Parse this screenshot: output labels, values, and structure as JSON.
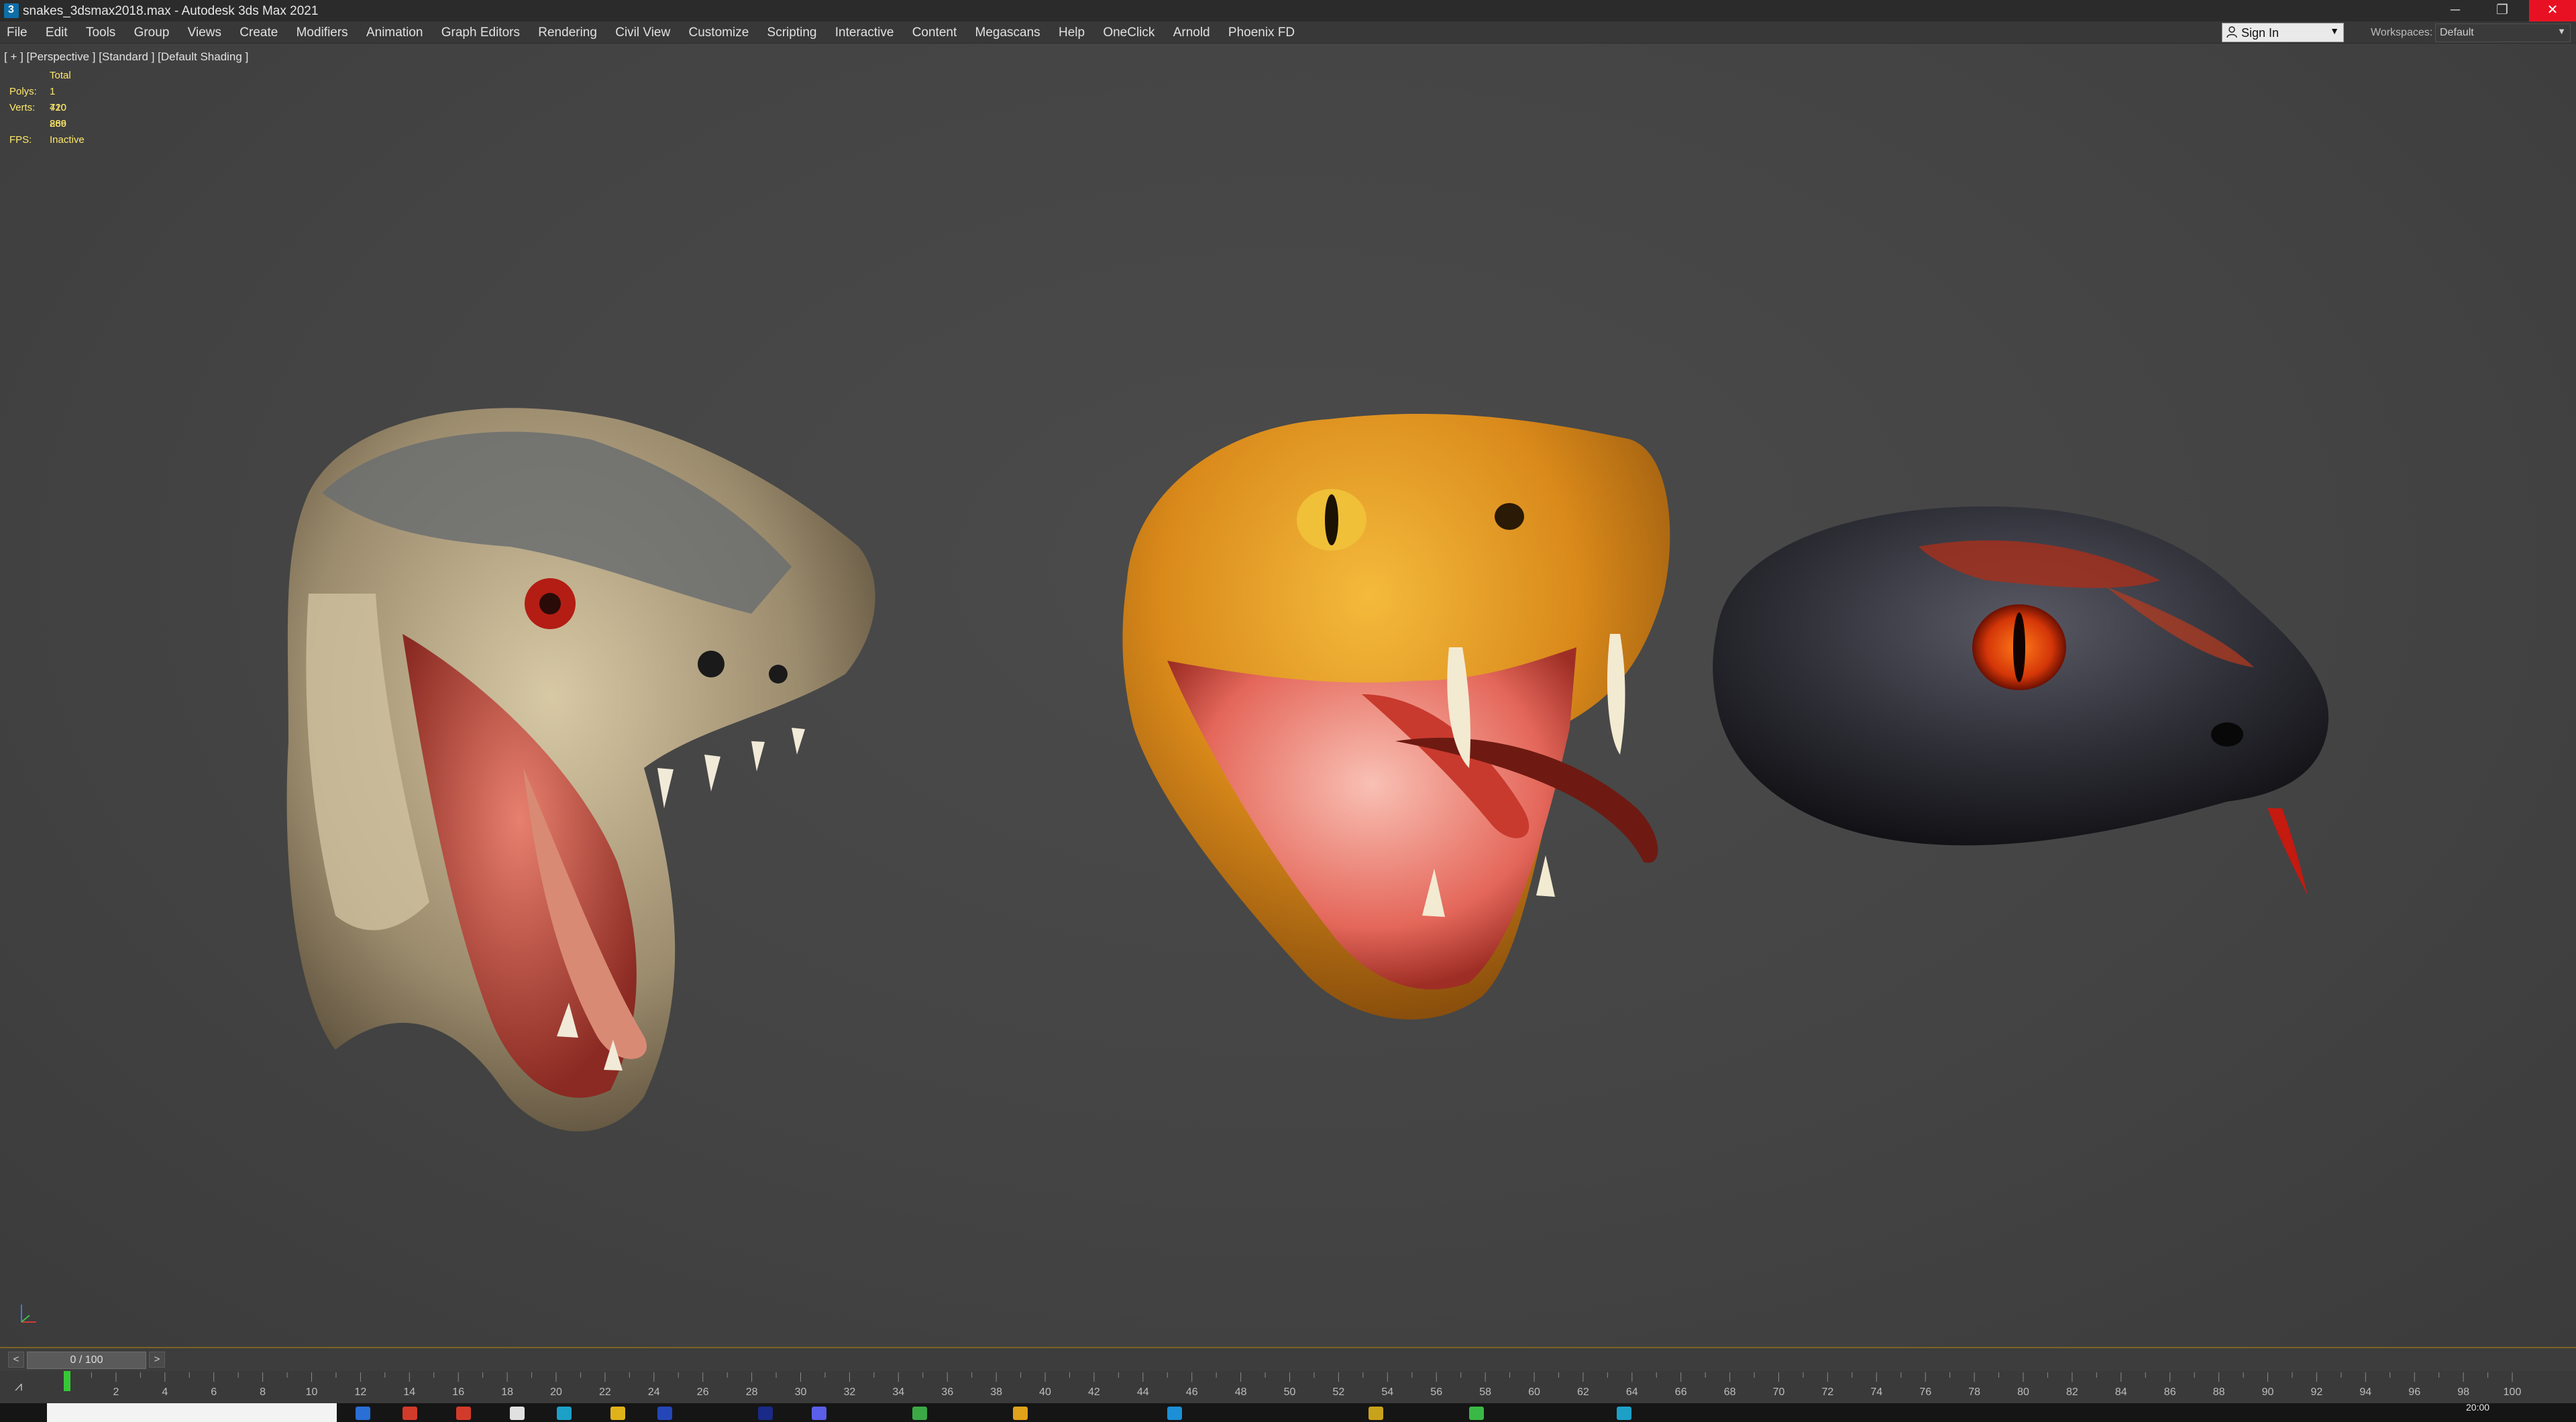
{
  "window": {
    "title": "snakes_3dsmax2018.max - Autodesk 3ds Max 2021",
    "minimize_symbol": "─",
    "restore_symbol": "❐",
    "close_symbol": "✕"
  },
  "menu": [
    "File",
    "Edit",
    "Tools",
    "Group",
    "Views",
    "Create",
    "Modifiers",
    "Animation",
    "Graph Editors",
    "Rendering",
    "Civil View",
    "Customize",
    "Scripting",
    "Interactive",
    "Content",
    "Megascans",
    "Help",
    "OneClick",
    "Arnold",
    "Phoenix FD"
  ],
  "account": {
    "sign_in_label": "Sign In",
    "caret": "▼"
  },
  "workspace": {
    "label": "Workspaces:",
    "value": "Default",
    "caret": "▼"
  },
  "viewport": {
    "label": "[ + ] [Perspective ] [Standard ] [Default Shading ]",
    "stats": {
      "header": "Total",
      "polys_label": "Polys:",
      "polys_value": "1 420 269",
      "verts_label": "Verts:",
      "verts_value": "710 886",
      "fps_label": "FPS:",
      "fps_value": "Inactive"
    }
  },
  "timeline": {
    "frame_display": "0 / 100",
    "prev_symbol": "<",
    "next_symbol": ">",
    "ticks": [
      2,
      4,
      6,
      8,
      10,
      12,
      14,
      16,
      18,
      20,
      22,
      24,
      26,
      28,
      30,
      32,
      34,
      36,
      38,
      40,
      42,
      44,
      46,
      48,
      50,
      52,
      54,
      56,
      58,
      60,
      62,
      64,
      66,
      68,
      70,
      72,
      74,
      76,
      78,
      80,
      82,
      84,
      86,
      88,
      90,
      92,
      94,
      96,
      98,
      100
    ],
    "range": [
      0,
      100
    ],
    "current_frame": 0
  },
  "taskbar": {
    "clock": "20:00"
  },
  "colors": {
    "viewport_bg": "#444444",
    "stats_text": "#ffe96a",
    "time_marker": "#37c837",
    "close_button": "#e81123"
  }
}
